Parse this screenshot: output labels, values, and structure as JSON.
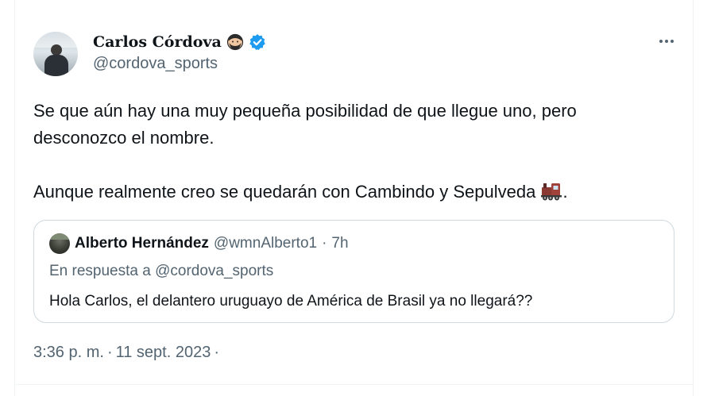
{
  "author": {
    "display_name": "Carlos Córdova",
    "handle": "@cordova_sports"
  },
  "tweet": {
    "lines": [
      "Se que aún hay una muy pequeña posibilidad de que llegue uno, pero",
      "desconozco el nombre.",
      "Aunque realmente creo se quedarán con Cambindo y Sepulveda"
    ],
    "trailing": "."
  },
  "quoted": {
    "display_name": "Alberto Hernández",
    "handle": "@wmnAlberto1",
    "separator": "·",
    "time": "7h",
    "reply_prefix": "En respuesta a",
    "reply_handle": "@cordova_sports",
    "text": "Hola Carlos, el delantero uruguayo de América de Brasil ya no llegará??"
  },
  "meta": {
    "time": "3:36 p. m.",
    "separator": "·",
    "date": "11 sept. 2023",
    "separator2": "·"
  },
  "icons": {
    "verified": "verified-badge-icon",
    "face_emoji": "bearded-face-emoji-icon",
    "train_emoji": "locomotive-emoji-icon",
    "more": "more-dots-icon"
  },
  "colors": {
    "verified_blue": "#1d9bf0",
    "secondary_text": "#536471",
    "border": "#cfd9de"
  }
}
